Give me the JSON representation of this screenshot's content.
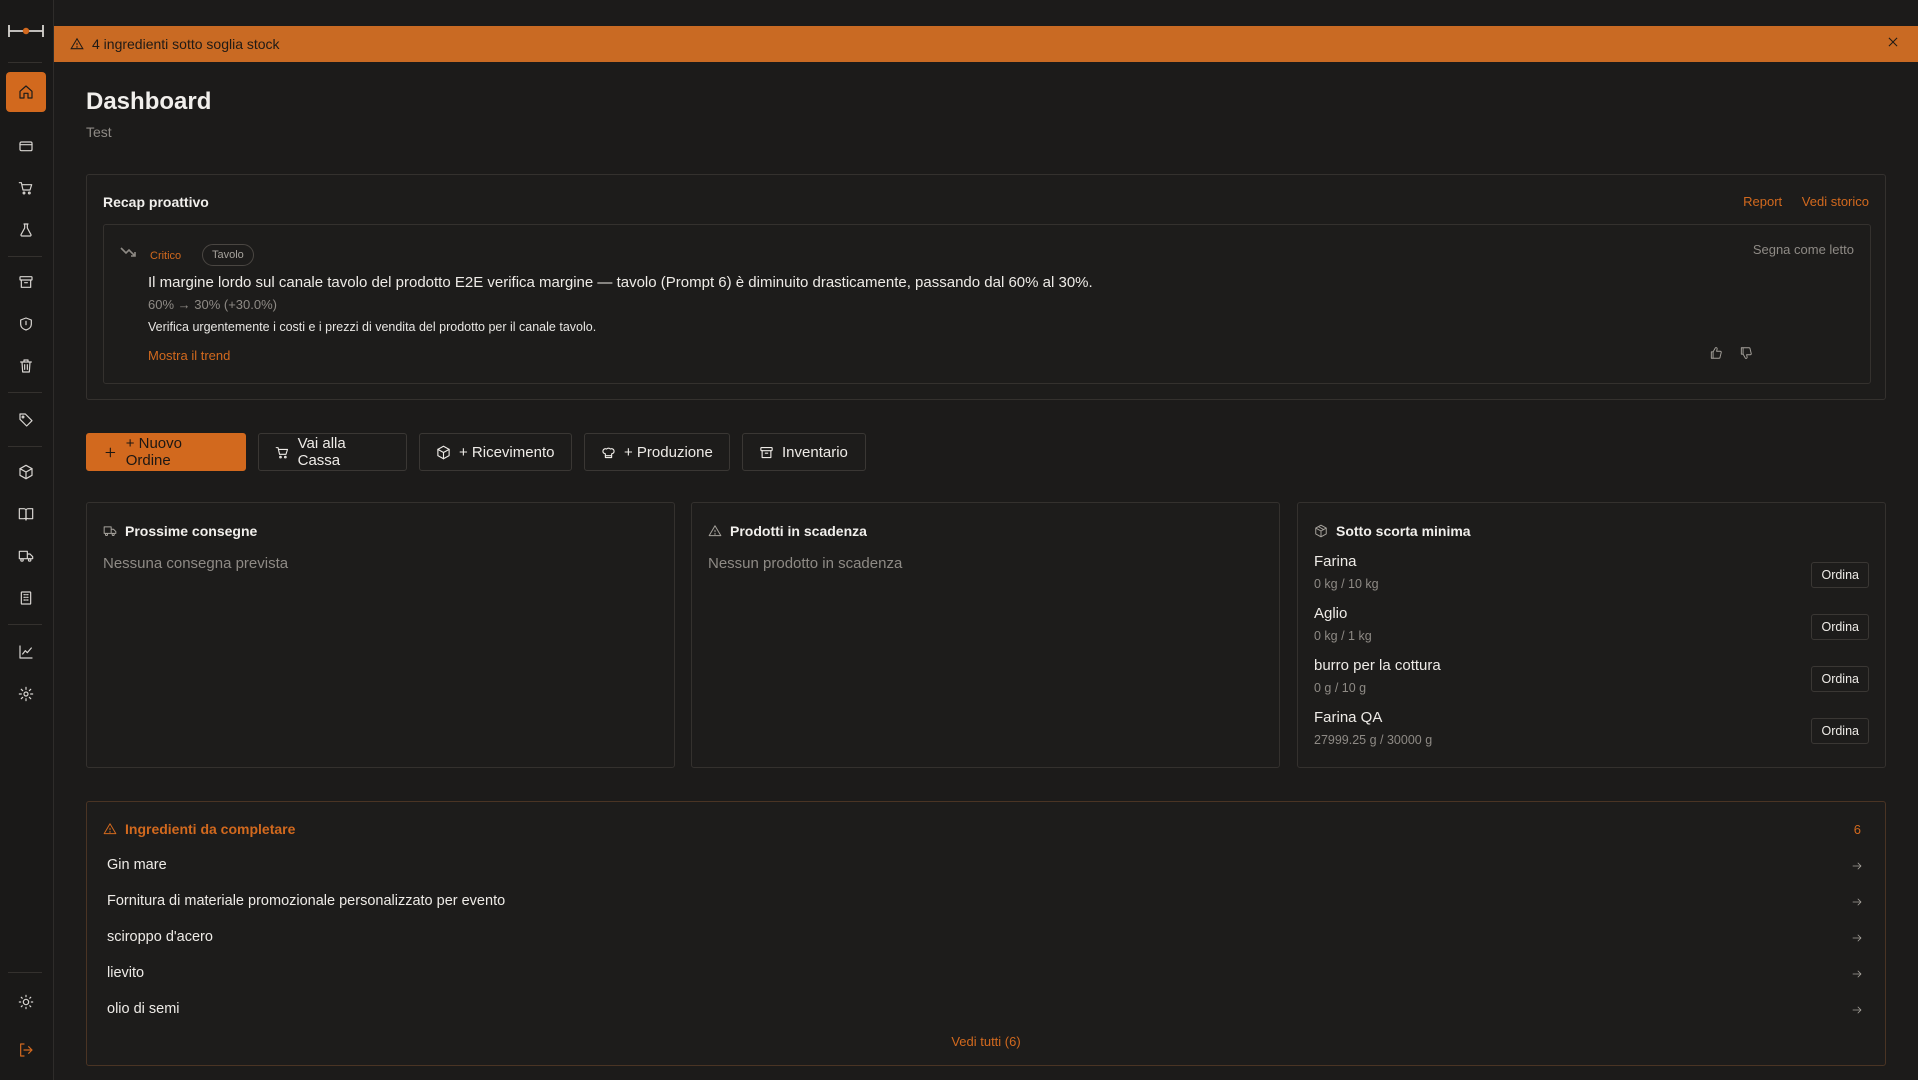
{
  "banner": {
    "text": "4 ingredienti sotto soglia stock"
  },
  "header": {
    "title": "Dashboard",
    "subtitle": "Test"
  },
  "recap": {
    "title": "Recap proattivo",
    "report_link": "Report",
    "history_link": "Vedi storico",
    "alert": {
      "severity": "Critico",
      "channel": "Tavolo",
      "mark_read": "Segna come letto",
      "message": "Il margine lordo sul canale tavolo del prodotto E2E verifica margine — tavolo (Prompt 6) è diminuito drasticamente, passando dal 60% al 30%.",
      "delta": "60% → 30% (+30.0%)",
      "action": "Verifica urgentemente i costi e i prezzi di vendita del prodotto per il canale tavolo.",
      "trend_link": "Mostra il trend"
    }
  },
  "actions": {
    "new_order": "+ Nuovo Ordine",
    "checkout": "Vai alla Cassa",
    "receiving": "+ Ricevimento",
    "production": "+ Produzione",
    "inventory": "Inventario"
  },
  "deliveries": {
    "title": "Prossime consegne",
    "empty": "Nessuna consegna prevista"
  },
  "expiring": {
    "title": "Prodotti in scadenza",
    "empty": "Nessun prodotto in scadenza"
  },
  "low_stock": {
    "title": "Sotto scorta minima",
    "order_label": "Ordina",
    "items": [
      {
        "name": "Farina",
        "qty": "0 kg / 10 kg"
      },
      {
        "name": "Aglio",
        "qty": "0 kg / 1 kg"
      },
      {
        "name": "burro per la cottura",
        "qty": "0 g / 10 g"
      },
      {
        "name": "Farina QA",
        "qty": "27999.25 g / 30000 g"
      }
    ]
  },
  "ingredients": {
    "title": "Ingredienti da completare",
    "count": "6",
    "items": [
      {
        "name": "Gin mare"
      },
      {
        "name": "Fornitura di materiale promozionale personalizzato per evento"
      },
      {
        "name": "sciroppo d'acero"
      },
      {
        "name": "lievito"
      },
      {
        "name": "olio di semi"
      }
    ],
    "view_all": "Vedi tutti (6)"
  },
  "colors": {
    "accent": "#d2691e",
    "background": "#1c1b1a",
    "border": "#34312e"
  }
}
